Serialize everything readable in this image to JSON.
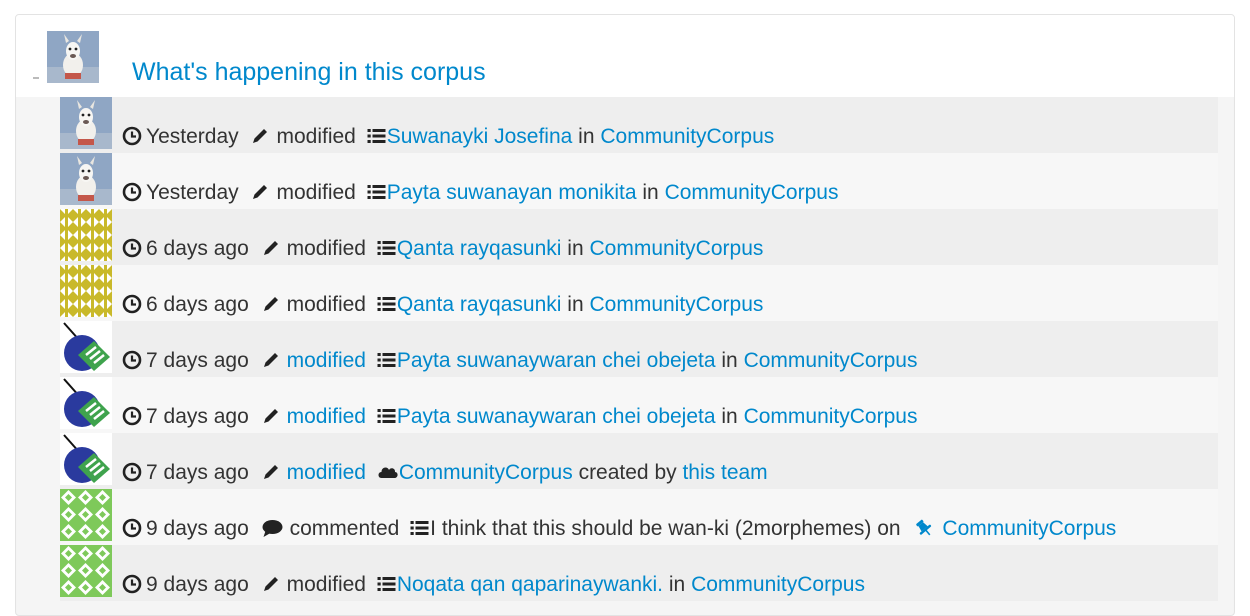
{
  "header": {
    "title": "What's happening in this corpus"
  },
  "rows": [
    {
      "avatar": "alpaca-avatar",
      "time": "Yesterday",
      "verb_icon": "pencil-icon",
      "verb": "modified",
      "verb_link": false,
      "object_icon": "list-icon",
      "object": "Suwanayki Josefina",
      "tail_prefix": "in",
      "tail_icon": "",
      "tail": "CommunityCorpus"
    },
    {
      "avatar": "alpaca-avatar",
      "time": "Yesterday",
      "verb_icon": "pencil-icon",
      "verb": "modified",
      "verb_link": false,
      "object_icon": "list-icon",
      "object": "Payta suwanayan monikita",
      "tail_prefix": "in",
      "tail_icon": "",
      "tail": "CommunityCorpus"
    },
    {
      "avatar": "yellow-pattern-avatar",
      "time": "6 days ago",
      "verb_icon": "pencil-icon",
      "verb": "modified",
      "verb_link": false,
      "object_icon": "list-icon",
      "object": "Qanta rayqasunki",
      "tail_prefix": "in",
      "tail_icon": "",
      "tail": "CommunityCorpus"
    },
    {
      "avatar": "yellow-pattern-avatar",
      "time": "6 days ago",
      "verb_icon": "pencil-icon",
      "verb": "modified",
      "verb_link": false,
      "object_icon": "list-icon",
      "object": "Qanta rayqasunki",
      "tail_prefix": "in",
      "tail_icon": "",
      "tail": "CommunityCorpus"
    },
    {
      "avatar": "blue-circle-avatar",
      "time": "7 days ago",
      "verb_icon": "pencil-icon",
      "verb": "modified",
      "verb_link": true,
      "object_icon": "list-icon",
      "object": "Payta suwanaywaran chei obejeta",
      "tail_prefix": "in",
      "tail_icon": "",
      "tail": "CommunityCorpus"
    },
    {
      "avatar": "blue-circle-avatar",
      "time": "7 days ago",
      "verb_icon": "pencil-icon",
      "verb": "modified",
      "verb_link": true,
      "object_icon": "list-icon",
      "object": "Payta suwanaywaran chei obejeta",
      "tail_prefix": "in",
      "tail_icon": "",
      "tail": "CommunityCorpus"
    },
    {
      "avatar": "blue-circle-avatar",
      "time": "7 days ago",
      "verb_icon": "pencil-icon",
      "verb": "modified",
      "verb_link": true,
      "object_icon": "cloud-icon",
      "object": "CommunityCorpus",
      "tail_prefix": "created by",
      "tail_icon": "",
      "tail": "this team"
    },
    {
      "avatar": "green-pattern-avatar",
      "time": "9 days ago",
      "verb_icon": "comment-icon",
      "verb": "commented",
      "verb_link": false,
      "object_icon": "list-icon",
      "object": "I think that this should be wan-ki (2morphemes)",
      "object_plain": true,
      "tail_prefix": "on",
      "tail_icon": "pushpin-icon",
      "tail": "CommunityCorpus"
    },
    {
      "avatar": "green-pattern-avatar",
      "time": "9 days ago",
      "verb_icon": "pencil-icon",
      "verb": "modified",
      "verb_link": false,
      "object_icon": "list-icon",
      "object": "Noqata qan qaparinaywanki.",
      "tail_prefix": "in",
      "tail_icon": "",
      "tail": "CommunityCorpus"
    }
  ]
}
